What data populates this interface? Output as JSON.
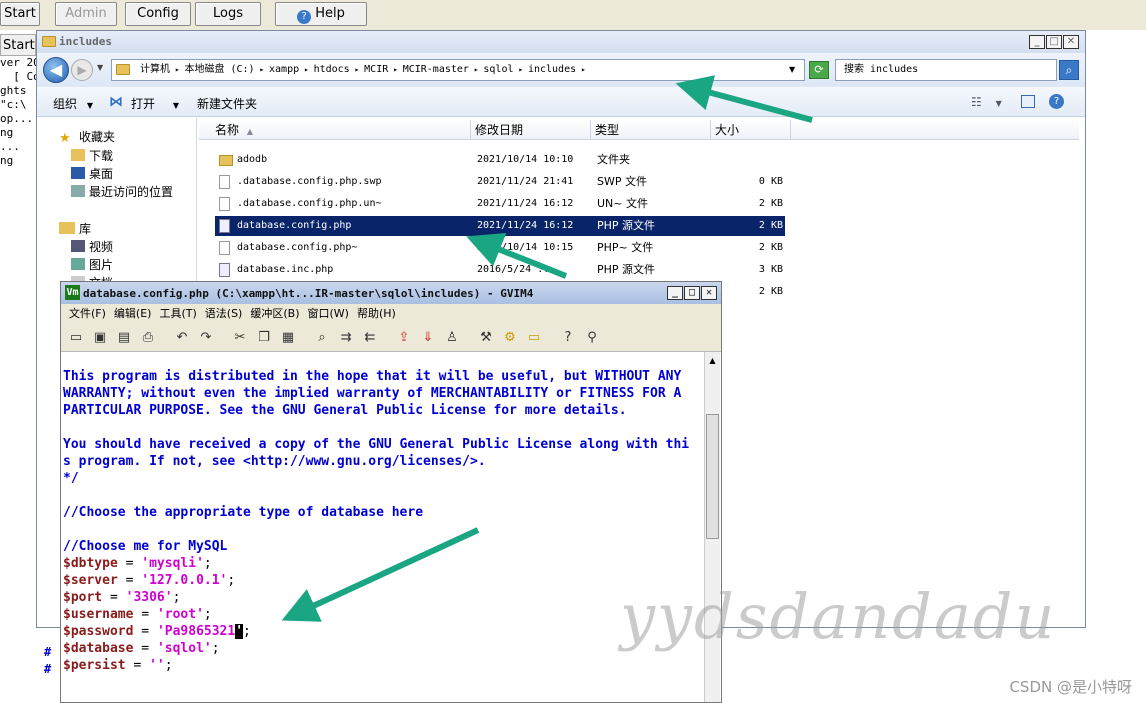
{
  "topbar": {
    "start": "Start",
    "admin": "Admin",
    "config": "Config",
    "logs": "Logs",
    "help": "Help"
  },
  "side": {
    "start": "Start"
  },
  "console": [
    "ver 20",
    "",
    "  [ Co",
    "ghts",
    "\"c:\\",
    "",
    "",
    "",
    "",
    "op...",
    "ng",
    "...",
    "ng"
  ],
  "explorer": {
    "title": "includes",
    "address": [
      "计算机",
      "本地磁盘 (C:)",
      "xampp",
      "htdocs",
      "MCIR",
      "MCIR-master",
      "sqlol",
      "includes"
    ],
    "search_placeholder": "搜索 includes",
    "commands": {
      "organize": "组织",
      "open": "打开",
      "new_folder": "新建文件夹"
    },
    "nav": {
      "favorites": "收藏夹",
      "downloads": "下载",
      "desktop": "桌面",
      "recent": "最近访问的位置",
      "libraries": "库",
      "videos": "视频",
      "pictures": "图片",
      "documents": "文档"
    },
    "columns": {
      "name": "名称",
      "date": "修改日期",
      "type": "类型",
      "size": "大小"
    },
    "files": [
      {
        "name": "adodb",
        "date": "2021/10/14 10:10",
        "type": "文件夹",
        "size": "",
        "icon": "folder"
      },
      {
        "name": ".database.config.php.swp",
        "date": "2021/11/24 21:41",
        "type": "SWP 文件",
        "size": "0 KB",
        "icon": "file"
      },
      {
        "name": ".database.config.php.un~",
        "date": "2021/11/24 16:12",
        "type": "UN~ 文件",
        "size": "2 KB",
        "icon": "file"
      },
      {
        "name": "database.config.php",
        "date": "2021/11/24 16:12",
        "type": "PHP 源文件",
        "size": "2 KB",
        "icon": "php"
      },
      {
        "name": "database.config.php~",
        "date": "2021/10/14 10:15",
        "type": "PHP~ 文件",
        "size": "2 KB",
        "icon": "file"
      },
      {
        "name": "database.inc.php",
        "date": "2016/5/24 ...",
        "type": "PHP 源文件",
        "size": "3 KB",
        "icon": "php"
      },
      {
        "name": "",
        "date": "",
        "type": "",
        "size": "2 KB",
        "icon": "none"
      }
    ]
  },
  "vim": {
    "title": "database.config.php (C:\\xampp\\ht...IR-master\\sqlol\\includes) - GVIM4",
    "logo": "Vm",
    "menu": [
      "文件(F)",
      "编辑(E)",
      "工具(T)",
      "语法(S)",
      "缓冲区(B)",
      "窗口(W)",
      "帮助(H)"
    ],
    "comment_lines": [
      "This program is distributed in the hope that it will be useful, but WITHOUT ANY",
      "WARRANTY; without even the implied warranty of MERCHANTABILITY or FITNESS FOR A",
      "PARTICULAR PURPOSE. See the GNU General Public License for more details.",
      "",
      "You should have received a copy of the GNU General Public License along with thi",
      "s program. If not, see <http://www.gnu.org/licenses/>.",
      "*/",
      "",
      "//Choose the appropriate type of database here",
      "",
      "//Choose me for MySQL"
    ],
    "vars": [
      {
        "name": "$dbtype",
        "value": "'mysqli'"
      },
      {
        "name": "$server",
        "value": "'127.0.0.1'"
      },
      {
        "name": "$port",
        "value": "'3306'"
      },
      {
        "name": "$username",
        "value": "'root'"
      },
      {
        "name": "$password",
        "value": "'Pa9865321'"
      },
      {
        "name": "$database",
        "value": "'sqlol'"
      },
      {
        "name": "$persist",
        "value": "''"
      }
    ],
    "cursor_char": "'"
  },
  "overlay": {
    "watermark": "CSDN @是小特呀",
    "scribble": "yydsdandadu"
  },
  "colors": {
    "arrow": "#1aa583",
    "selection": "#0a246a",
    "vim_comment": "#0000d0",
    "vim_var": "#8b1a1a",
    "vim_string": "#d000d0"
  }
}
